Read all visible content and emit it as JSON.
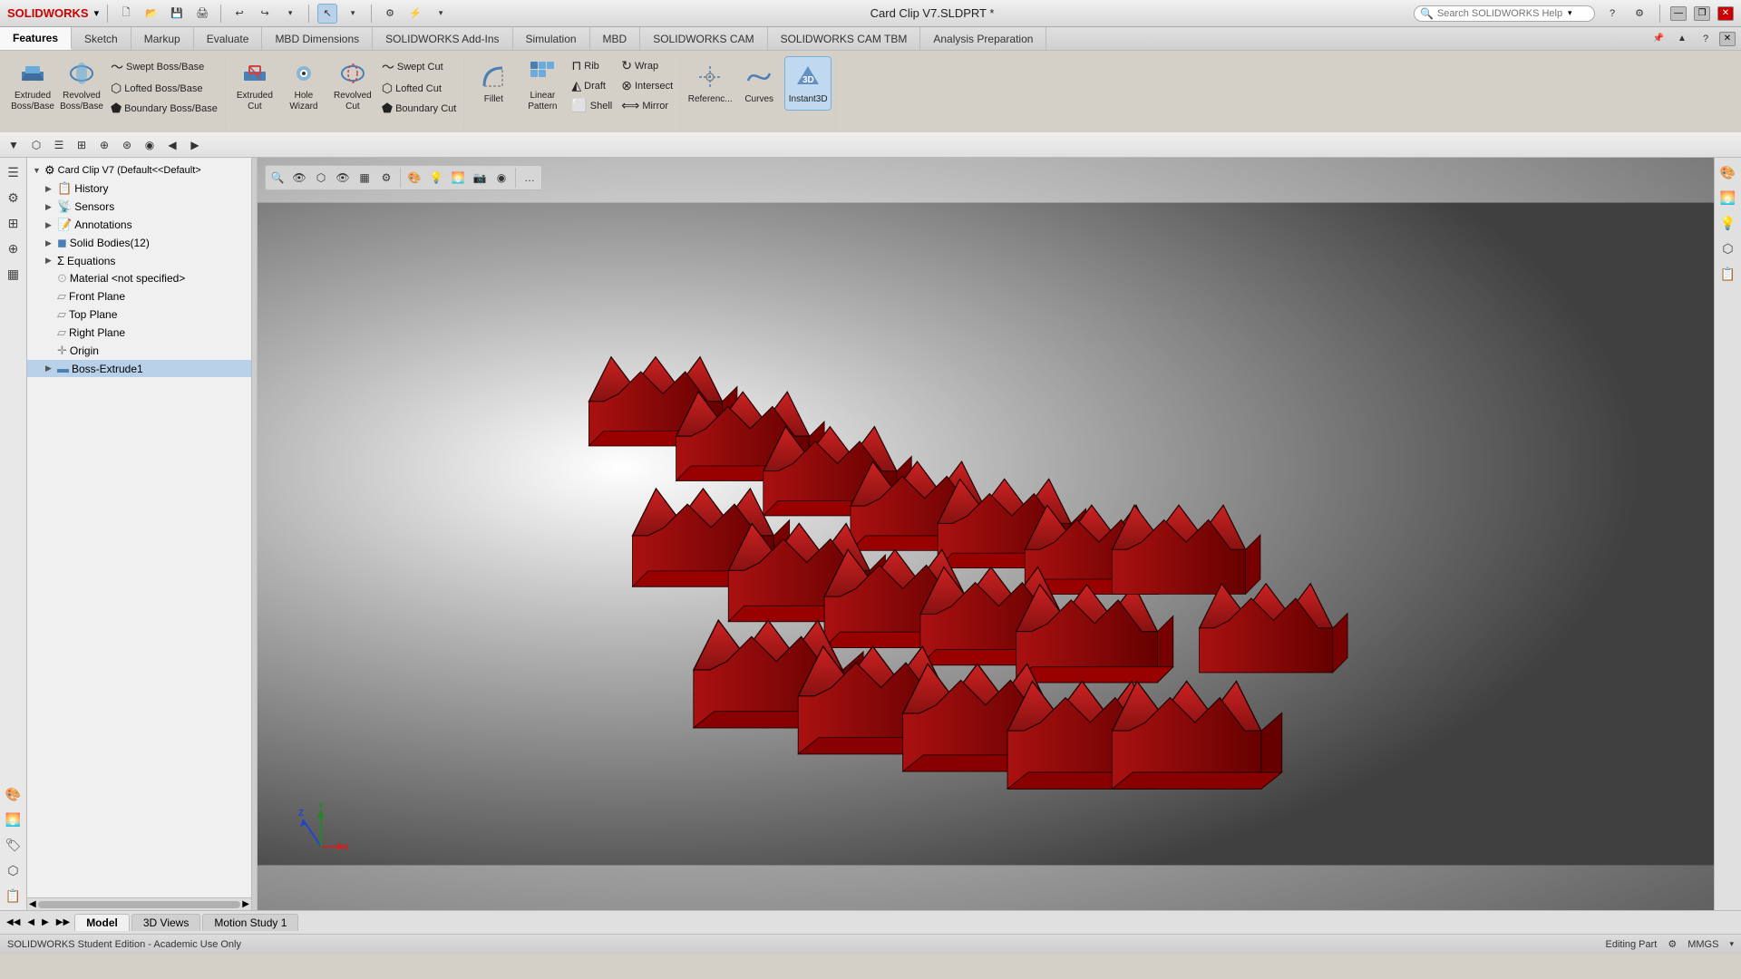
{
  "app": {
    "logo": "SOLIDWORKS",
    "title": "Card Clip V7.SLDPRT *",
    "status": "Editing Part",
    "units": "MMGS",
    "edition": "SOLIDWORKS Student Edition - Academic Use Only"
  },
  "titlebar": {
    "window_controls": [
      "—",
      "❐",
      "✕"
    ],
    "search_placeholder": "Search SOLIDWORKS Help",
    "help_icon": "?",
    "settings_icon": "⚙"
  },
  "quick_toolbar": {
    "buttons": [
      {
        "name": "new",
        "icon": "🗋",
        "label": "New"
      },
      {
        "name": "open",
        "icon": "📂",
        "label": "Open"
      },
      {
        "name": "save",
        "icon": "💾",
        "label": "Save"
      },
      {
        "name": "print",
        "icon": "🖨",
        "label": "Print"
      },
      {
        "name": "undo",
        "icon": "↩",
        "label": "Undo"
      },
      {
        "name": "redo",
        "icon": "↪",
        "label": "Redo"
      },
      {
        "name": "customize",
        "icon": "▾",
        "label": "Customize"
      }
    ]
  },
  "ribbon": {
    "tabs": [
      {
        "id": "features",
        "label": "Features",
        "active": true
      },
      {
        "id": "sketch",
        "label": "Sketch"
      },
      {
        "id": "markup",
        "label": "Markup"
      },
      {
        "id": "evaluate",
        "label": "Evaluate"
      },
      {
        "id": "mbd-dimensions",
        "label": "MBD Dimensions"
      },
      {
        "id": "solidworks-addins",
        "label": "SOLIDWORKS Add-Ins"
      },
      {
        "id": "simulation",
        "label": "Simulation"
      },
      {
        "id": "mbd",
        "label": "MBD"
      },
      {
        "id": "solidworks-cam",
        "label": "SOLIDWORKS CAM"
      },
      {
        "id": "solidworks-cam-tbm",
        "label": "SOLIDWORKS CAM TBM"
      },
      {
        "id": "analysis-preparation",
        "label": "Analysis Preparation"
      }
    ],
    "groups": [
      {
        "name": "boss-base",
        "buttons_large": [
          {
            "id": "extruded-boss-base",
            "label": "Extruded\nBoss/Base",
            "icon": "▬"
          },
          {
            "id": "revolved-boss-base",
            "label": "Revolved\nBoss/Base",
            "icon": "⭕"
          }
        ],
        "buttons_small_col1": [
          {
            "id": "swept-boss-base",
            "label": "Swept Boss/Base"
          },
          {
            "id": "lofted-boss-base",
            "label": "Lofted Boss/Base"
          },
          {
            "id": "boundary-boss-base",
            "label": "Boundary Boss/Base"
          }
        ]
      }
    ],
    "cut_buttons_large": [
      {
        "id": "extruded-cut",
        "label": "Extruded\nCut",
        "icon": "▬"
      },
      {
        "id": "hole-wizard",
        "label": "Hole Wizard",
        "icon": "⊙"
      },
      {
        "id": "revolved-cut",
        "label": "Revolved\nCut",
        "icon": "⭕"
      }
    ],
    "cut_buttons_small": [
      {
        "id": "swept-cut",
        "label": "Swept Cut"
      },
      {
        "id": "lofted-cut",
        "label": "Lofted Cut"
      },
      {
        "id": "boundary-cut",
        "label": "Boundary Cut"
      }
    ],
    "features_buttons_large": [
      {
        "id": "fillet",
        "label": "Fillet",
        "icon": "⌒"
      },
      {
        "id": "linear-pattern",
        "label": "Linear Pattern",
        "icon": "⊞"
      }
    ],
    "features_buttons_small_col1": [
      {
        "id": "rib",
        "label": "Rib"
      },
      {
        "id": "draft",
        "label": "Draft"
      },
      {
        "id": "shell",
        "label": "Shell"
      }
    ],
    "features_buttons_small_col2": [
      {
        "id": "wrap",
        "label": "Wrap"
      },
      {
        "id": "intersect",
        "label": "Intersect"
      },
      {
        "id": "mirror",
        "label": "Mirror"
      }
    ],
    "reference_btn": {
      "id": "references",
      "label": "Referenc...",
      "icon": "◈"
    },
    "curves_btn": {
      "id": "curves",
      "label": "Curves",
      "icon": "〜"
    },
    "instant3d_btn": {
      "id": "instant3d",
      "label": "Instant3D",
      "active": true
    }
  },
  "second_toolbar": {
    "buttons": [
      "⬡",
      "☰",
      "⊞",
      "⊕",
      "⊛",
      "◉",
      "▶",
      "◀",
      "▸"
    ]
  },
  "feature_tree": {
    "root": "Card Clip V7  (Default<<Default>",
    "items": [
      {
        "id": "history",
        "label": "History",
        "icon": "📋",
        "indent": 1,
        "expandable": true
      },
      {
        "id": "sensors",
        "label": "Sensors",
        "icon": "📡",
        "indent": 1
      },
      {
        "id": "annotations",
        "label": "Annotations",
        "icon": "📝",
        "indent": 1
      },
      {
        "id": "solid-bodies",
        "label": "Solid Bodies(12)",
        "icon": "◼",
        "indent": 1
      },
      {
        "id": "equations",
        "label": "Equations",
        "icon": "=",
        "indent": 1
      },
      {
        "id": "material",
        "label": "Material <not specified>",
        "icon": "⚬",
        "indent": 1
      },
      {
        "id": "front-plane",
        "label": "Front Plane",
        "icon": "▱",
        "indent": 1
      },
      {
        "id": "top-plane",
        "label": "Top Plane",
        "icon": "▱",
        "indent": 1
      },
      {
        "id": "right-plane",
        "label": "Right Plane",
        "icon": "▱",
        "indent": 1
      },
      {
        "id": "origin",
        "label": "Origin",
        "icon": "✛",
        "indent": 1
      },
      {
        "id": "boss-extrude1",
        "label": "Boss-Extrude1",
        "icon": "▬",
        "indent": 1,
        "selected": true
      }
    ]
  },
  "bottom_tabs": {
    "nav_buttons": [
      "◀◀",
      "◀",
      "▶",
      "▶▶"
    ],
    "tabs": [
      {
        "id": "model",
        "label": "Model",
        "active": true
      },
      {
        "id": "3d-views",
        "label": "3D Views"
      },
      {
        "id": "motion-study-1",
        "label": "Motion Study 1"
      }
    ]
  },
  "viewport_toolbar": {
    "buttons": [
      "🔍",
      "👁",
      "⬡",
      "📐",
      "🎨",
      "💡",
      "◼",
      "⚪",
      "🌀",
      "◈",
      "⬛",
      "…"
    ]
  },
  "axes": {
    "x_color": "#cc0000",
    "y_color": "#00aa00",
    "z_color": "#0000cc",
    "x_label": "X",
    "y_label": "Y",
    "z_label": "Z"
  },
  "statusbar": {
    "edition_text": "SOLIDWORKS Student Edition - Academic Use Only",
    "editing_text": "Editing Part",
    "units": "MMGS",
    "icon": "⚙"
  }
}
